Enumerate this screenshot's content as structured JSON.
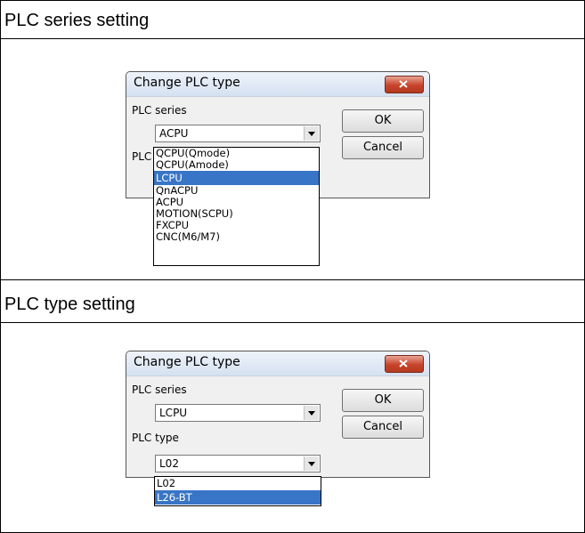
{
  "sections": [
    {
      "heading": "PLC series setting",
      "dialog": {
        "title": "Change PLC type",
        "series_label": "PLC series",
        "series_value": "ACPU",
        "type_label_partial": "PLC",
        "ok_label": "OK",
        "cancel_label": "Cancel",
        "dropdown_options": [
          "QCPU(Qmode)",
          "QCPU(Amode)",
          "LCPU",
          "QnACPU",
          "ACPU",
          "MOTION(SCPU)",
          "FXCPU",
          "CNC(M6/M7)"
        ],
        "dropdown_selected_index": 2
      }
    },
    {
      "heading": "PLC type setting",
      "dialog": {
        "title": "Change PLC type",
        "series_label": "PLC series",
        "series_value": "LCPU",
        "type_label": "PLC type",
        "type_value": "L02",
        "ok_label": "OK",
        "cancel_label": "Cancel",
        "dropdown_options": [
          "L02",
          "L26-BT"
        ],
        "dropdown_selected_index": 1
      }
    }
  ],
  "colors": {
    "selection": "#3875c6",
    "close_button": "#c7442b",
    "dialog_bg": "#f0f0f0"
  }
}
